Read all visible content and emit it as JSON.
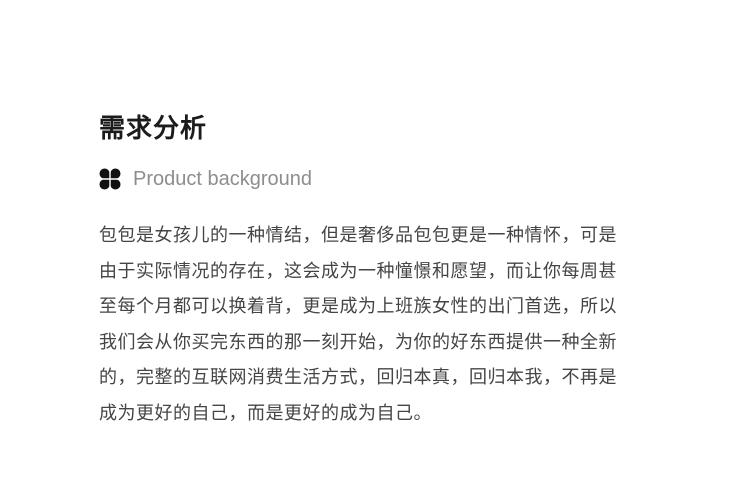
{
  "section": {
    "title": "需求分析",
    "subtitle": "Product background",
    "icon": "four-petal-clover-icon",
    "text_color": "#454545",
    "title_color": "#1b1b1b",
    "subtitle_color": "#8d8d8d",
    "body_lines": [
      "包包是女孩儿的一种情结，但是奢侈品包包更是一种情怀，可是",
      "由于实际情况的存在，这会成为一种憧憬和愿望，而让你每周甚",
      "至每个月都可以换着背，更是成为上班族女性的出门首选，所以",
      "我们会从你买完东西的那一刻开始，为你的好东西提供一种全新",
      "的，完整的互联网消费生活方式，回归本真，回归本我，不再是",
      "成为更好的自己，而是更好的成为自己。"
    ]
  }
}
